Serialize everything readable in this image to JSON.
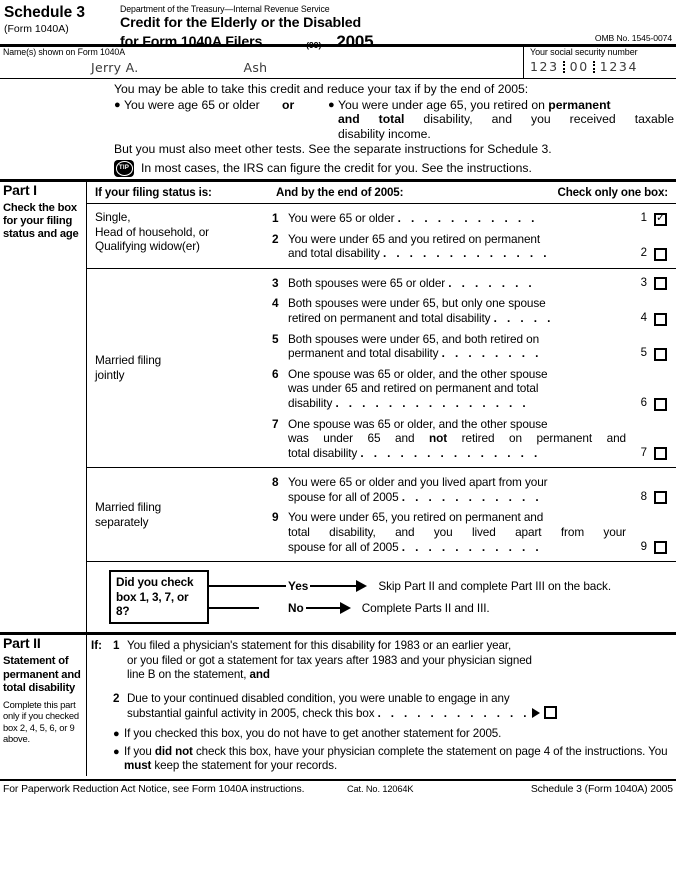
{
  "header": {
    "schedule_title": "Schedule 3",
    "schedule_sub": "(Form 1040A)",
    "department_line": "Department of the Treasury—Internal Revenue Service",
    "form_title_line1": "Credit for the Elderly or the Disabled",
    "form_title_line2": "for Form 1040A Filers",
    "code99": "(99)",
    "year": "2005",
    "omb": "OMB No. 1545-0074"
  },
  "name_row": {
    "name_label": "Name(s) shown on Form 1040A",
    "first_name": "Jerry A.",
    "last_name": "Ash",
    "ssn_label": "Your social security number",
    "ssn_part1": "123",
    "ssn_part2": "00",
    "ssn_part3": "1234"
  },
  "intro": {
    "lead": "You may be able to take this credit and reduce your tax if by the end of 2005:",
    "bullet_left": "You were age 65 or older",
    "or_label": "or",
    "bullet_right_pre": "You were under age 65, you retired on ",
    "bullet_right_bold1": "permanent",
    "bullet_right_bold2": "and total",
    "bullet_right_mid": " disability, and you received taxable",
    "bullet_right_end": "disability income.",
    "other_tests": "But you must also meet other tests. See the separate instructions for Schedule 3.",
    "tip_icon_label": "TIP",
    "tip_text": "In most cases, the IRS can figure the credit for you. See the instructions."
  },
  "part1": {
    "title": "Part I",
    "description": "Check the box for your filing status and age",
    "col_status": "If your filing status is:",
    "col_end": "And by the end of 2005:",
    "col_check": "Check only one box:",
    "groups": [
      {
        "label_lines": [
          "Single,",
          "Head of household, or",
          "Qualifying widow(er)"
        ],
        "items": [
          {
            "num": "1",
            "lines": [
              "You were 65 or older"
            ],
            "leader": ". . . . . . . . . . .",
            "tail_num": "1",
            "checked": true
          },
          {
            "num": "2",
            "lines": [
              "You were under 65 and you retired on permanent",
              "and total disability"
            ],
            "leader": ". . . . . . . . . . . . .",
            "tail_num": "2",
            "checked": false
          }
        ]
      },
      {
        "label_lines": [
          "Married filing",
          "jointly"
        ],
        "items": [
          {
            "num": "3",
            "lines": [
              "Both spouses were 65 or older"
            ],
            "leader": ". . . . . . .",
            "tail_num": "3",
            "checked": false
          },
          {
            "num": "4",
            "lines": [
              "Both spouses were under 65, but only one spouse",
              "retired on permanent and total disability"
            ],
            "leader": ". . . . .",
            "tail_num": "4",
            "checked": false
          },
          {
            "num": "5",
            "lines": [
              "Both spouses were under 65, and both retired on",
              "permanent and total disability"
            ],
            "leader": ". . . . . . . .",
            "tail_num": "5",
            "checked": false
          },
          {
            "num": "6",
            "lines": [
              "One spouse was 65 or older, and the other spouse",
              "was under 65 and retired on permanent and total",
              "disability"
            ],
            "leader": ". . . . . . . . . . . . . . .",
            "tail_num": "6",
            "checked": false
          },
          {
            "num": "7",
            "lines": [
              "One spouse was 65 or older, and the other spouse",
              "was under 65 and not retired on permanent and",
              "total disability"
            ],
            "bold_word": "not",
            "leader": ". . . . . . . . . . . . . .",
            "tail_num": "7",
            "checked": false
          }
        ]
      },
      {
        "label_lines": [
          "Married filing",
          "separately"
        ],
        "items": [
          {
            "num": "8",
            "lines": [
              "You were 65 or older and you lived apart from your",
              "spouse for all of 2005"
            ],
            "leader": ". . . . . . . . . . .",
            "tail_num": "8",
            "checked": false
          },
          {
            "num": "9",
            "lines": [
              "You were under 65, you retired on permanent and",
              "total  disability,  and  you  lived  apart  from  your",
              "spouse for all of 2005"
            ],
            "leader": ". . . . . . . . . . .",
            "tail_num": "9",
            "checked": false
          }
        ]
      }
    ]
  },
  "decision": {
    "question_lines": [
      "Did you check",
      "box 1, 3, 7, or",
      "8?"
    ],
    "yes_label": "Yes",
    "yes_text": "Skip Part II and complete Part III on the back.",
    "no_label": "No",
    "no_text": "Complete Parts II and III."
  },
  "part2": {
    "title": "Part II",
    "description": "Statement of permanent and total disability",
    "note": "Complete this part only if you checked box 2, 4, 5, 6, or 9 above.",
    "if_label": "If:",
    "item1": {
      "num": "1",
      "line1": "You filed a physician's statement for this disability for 1983 or an earlier year,",
      "line2": "or you filed or got a statement for tax years after 1983 and your physician signed",
      "line3_pre": "line B on the statement, ",
      "line3_bold": "and"
    },
    "item2": {
      "num": "2",
      "line1": "Due to your continued disabled condition, you were unable to engage in any",
      "line2": "substantial gainful activity in 2005, check this box",
      "leader": ". . . . . . . . . . . ."
    },
    "bullets": [
      {
        "text": "If you checked this box, you do not have to get another statement for 2005."
      },
      {
        "pre": "If you ",
        "bold1": "did not",
        "mid": " check this box, have your physician complete the statement on page 4 of the instructions. You ",
        "bold2": "must",
        "post": " keep the statement for your records."
      }
    ]
  },
  "footer": {
    "left": "For Paperwork Reduction Act Notice, see Form 1040A instructions.",
    "cat": "Cat. No. 12064K",
    "right": "Schedule 3 (Form 1040A) 2005"
  }
}
